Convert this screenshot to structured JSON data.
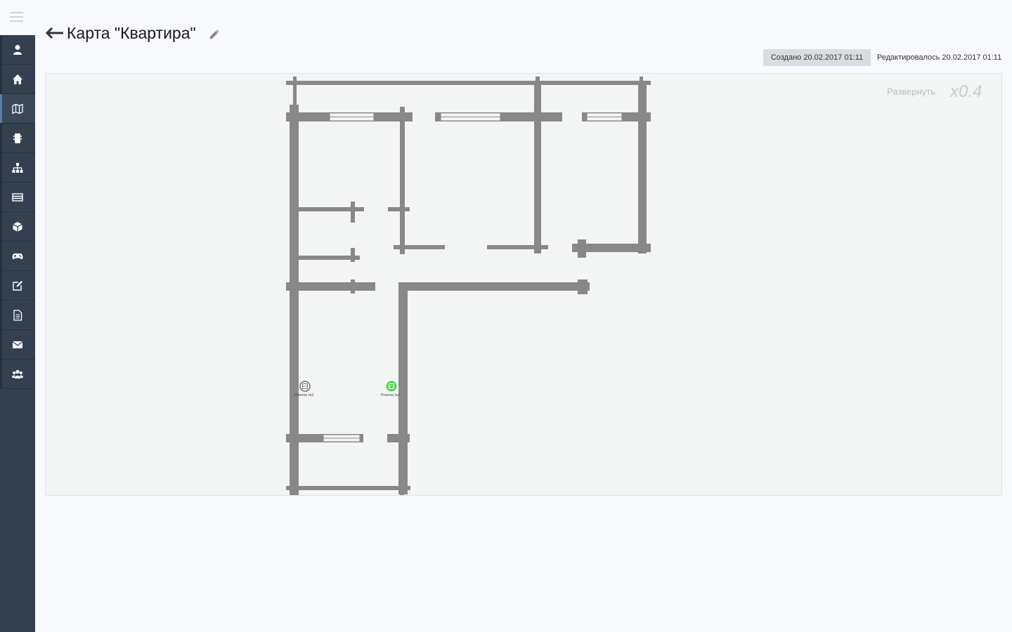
{
  "sidebar": {
    "items": [
      {
        "icon": "user-icon"
      },
      {
        "icon": "home-icon"
      },
      {
        "icon": "map-icon",
        "active": true
      },
      {
        "icon": "device-icon"
      },
      {
        "icon": "sitemap-icon"
      },
      {
        "icon": "list-icon"
      },
      {
        "icon": "cube-icon"
      },
      {
        "icon": "gamepad-icon"
      },
      {
        "icon": "edit-icon"
      },
      {
        "icon": "document-icon"
      },
      {
        "icon": "envelope-icon"
      },
      {
        "icon": "users-icon"
      }
    ]
  },
  "header": {
    "title": "Карта \"Квартира\"",
    "created": "Создано 20.02.2017 01:11",
    "edited": "Редактировалось 20.02.2017 01:11"
  },
  "map": {
    "expand_label": "Развернуть",
    "zoom": "x0.4",
    "devices": [
      {
        "label": "Розетка №2",
        "status": "inactive"
      },
      {
        "label": "Розетка №1",
        "status": "active"
      }
    ]
  },
  "colors": {
    "sidebar": "#34404f",
    "wall": "#888888",
    "device_active": "#4cd64c",
    "device_inactive": "#6e6e6e"
  }
}
